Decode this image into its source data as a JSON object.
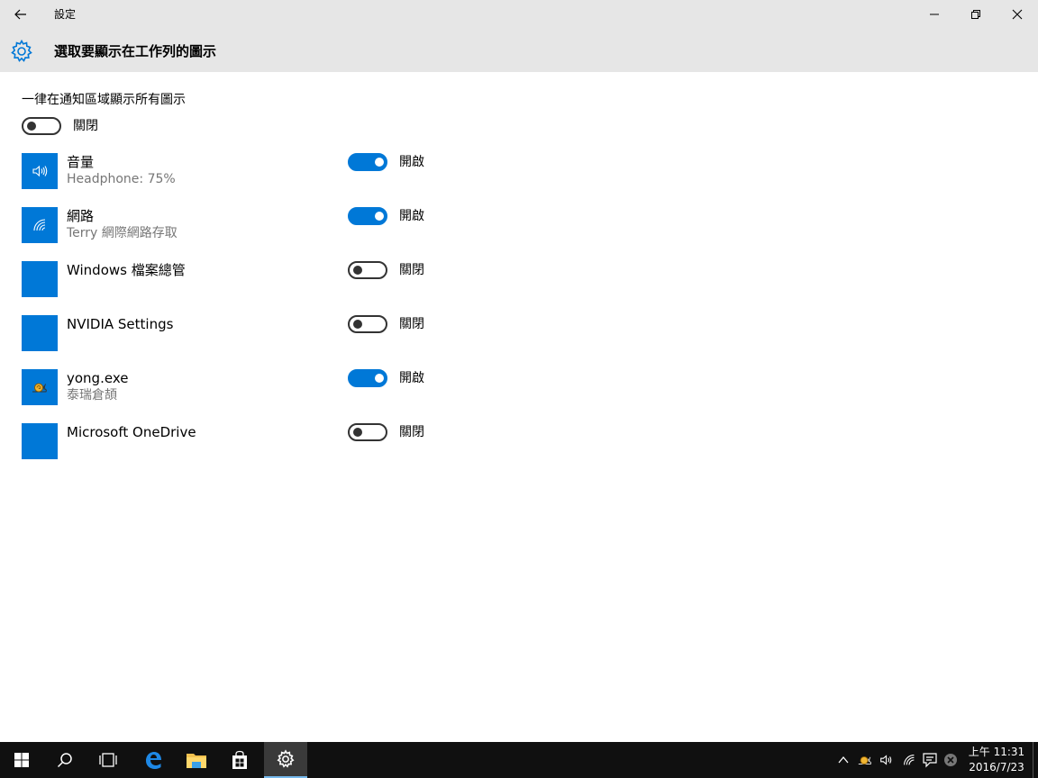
{
  "window": {
    "title": "設定"
  },
  "header": {
    "title": "選取要顯示在工作列的圖示"
  },
  "master": {
    "label": "一律在通知區域顯示所有圖示",
    "state": "關閉",
    "on": false
  },
  "apps": [
    {
      "name": "音量",
      "subtitle": "Headphone: 75%",
      "state": "開啟",
      "on": true,
      "icon": "speaker-icon"
    },
    {
      "name": "網路",
      "subtitle": "Terry 網際網路存取",
      "state": "開啟",
      "on": true,
      "icon": "wifi-icon"
    },
    {
      "name": "Windows 檔案總管",
      "subtitle": "",
      "state": "關閉",
      "on": false,
      "icon": ""
    },
    {
      "name": "NVIDIA Settings",
      "subtitle": "",
      "state": "關閉",
      "on": false,
      "icon": ""
    },
    {
      "name": "yong.exe",
      "subtitle": "泰瑞倉頡",
      "state": "開啟",
      "on": true,
      "icon": "snail-icon"
    },
    {
      "name": "Microsoft OneDrive",
      "subtitle": "",
      "state": "關閉",
      "on": false,
      "icon": ""
    }
  ],
  "taskbar": {
    "buttons": [
      "start-icon",
      "search-icon",
      "task-view-icon",
      "edge-icon",
      "file-explorer-icon",
      "store-icon",
      "settings-icon"
    ],
    "active": "settings-icon"
  },
  "tray": {
    "icons": [
      "chevron-up-icon",
      "snail-icon",
      "speaker-icon",
      "wifi-icon",
      "action-center-icon",
      "close-circle-icon"
    ]
  },
  "clock": {
    "time": "上午 11:31",
    "date": "2016/7/23"
  },
  "colors": {
    "accent": "#0078d7",
    "chrome": "#e6e6e6",
    "taskbar": "#101010",
    "subtitle": "#767676"
  }
}
